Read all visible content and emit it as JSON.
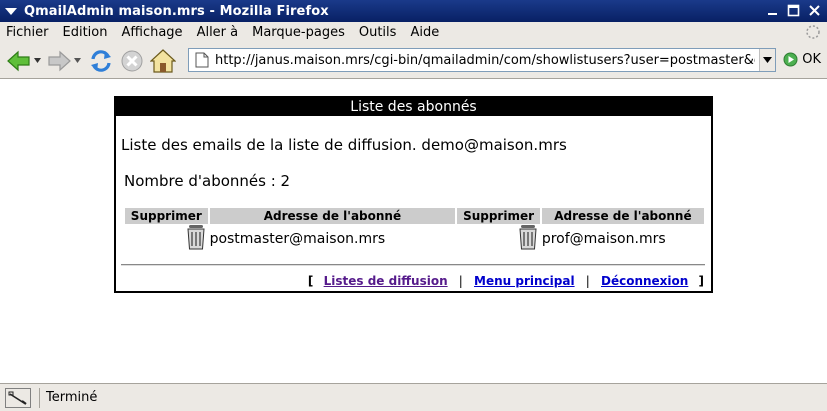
{
  "window": {
    "title": "QmailAdmin maison.mrs - Mozilla Firefox"
  },
  "menu": {
    "items": [
      "Fichier",
      "Edition",
      "Affichage",
      "Aller à",
      "Marque-pages",
      "Outils",
      "Aide"
    ]
  },
  "navbar": {
    "url": "http://janus.maison.mrs/cgi-bin/qmailadmin/com/showlistusers?user=postmaster&dom",
    "go_label": "OK"
  },
  "panel": {
    "header": "Liste des abonnés",
    "description": "Liste des emails de la liste de diffusion. demo@maison.mrs",
    "count": "Nombre d'abonnés : 2",
    "columns": [
      "Supprimer",
      "Adresse de l'abonné",
      "Supprimer",
      "Adresse de l'abonné"
    ],
    "subscribers": [
      "postmaster@maison.mrs",
      "prof@maison.mrs"
    ],
    "links": {
      "open_bracket": "[",
      "mailing_lists": "Listes de diffusion",
      "main_menu": "Menu principal",
      "logout": "Déconnexion",
      "separator": "|",
      "close_bracket": "]"
    }
  },
  "status": {
    "text": "Terminé"
  },
  "colors": {
    "titlebar": "#0a246a",
    "chrome": "#ece9e4",
    "header_bg": "#000000",
    "table_header_bg": "#cccccc",
    "link_visited": "#551a8b",
    "link": "#0000cc"
  },
  "icons": {
    "back": "back-arrow-icon",
    "forward": "forward-arrow-icon",
    "reload": "reload-icon",
    "stop": "stop-icon",
    "home": "home-icon",
    "trash": "trash-icon"
  }
}
